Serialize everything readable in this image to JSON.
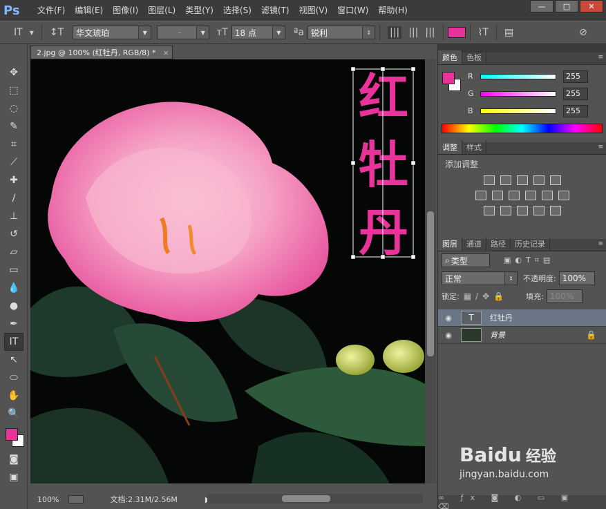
{
  "app": {
    "logo": "Ps"
  },
  "menus": [
    "文件(F)",
    "编辑(E)",
    "图像(I)",
    "图层(L)",
    "类型(Y)",
    "选择(S)",
    "滤镜(T)",
    "视图(V)",
    "窗口(W)",
    "帮助(H)"
  ],
  "window_buttons": [
    "—",
    "□",
    "✕"
  ],
  "options": {
    "font_family": "华文琥珀",
    "font_style": "-",
    "font_size": "18 点",
    "aa_label": "ªa",
    "antialias": "锐利",
    "text_color": "#e8339b"
  },
  "document": {
    "tab_title": "2.jpg @ 100% (红牡丹, RGB/8) *",
    "close": "×",
    "text_layer": [
      "红",
      "牡",
      "丹"
    ],
    "text_color": "#e8339b",
    "zoom": "100%",
    "doc_info": "文档:2.31M/2.56M"
  },
  "color_panel": {
    "tabs": [
      "颜色",
      "色板"
    ],
    "channels": [
      {
        "label": "R",
        "value": "255",
        "gradient": "linear-gradient(90deg,#00ffff,#ffffff)"
      },
      {
        "label": "G",
        "value": "255",
        "gradient": "linear-gradient(90deg,#ff00ff,#ffffff)"
      },
      {
        "label": "B",
        "value": "255",
        "gradient": "linear-gradient(90deg,#ffff00,#ffffff)"
      }
    ],
    "fg_color": "#e8339b",
    "bg_color": "#ffffff"
  },
  "adjust_panel": {
    "tabs": [
      "调整",
      "样式"
    ],
    "title": "添加调整"
  },
  "layers_panel": {
    "tabs": [
      "图层",
      "通道",
      "路径",
      "历史记录"
    ],
    "filter": "类型",
    "blend_mode": "正常",
    "opacity_label": "不透明度:",
    "opacity": "100%",
    "lock_label": "锁定:",
    "fill_label": "填充:",
    "fill": "100%",
    "layers": [
      {
        "name": "红牡丹",
        "thumb": "T",
        "selected": true
      },
      {
        "name": "背景",
        "thumb": "",
        "selected": false,
        "locked": true
      }
    ]
  },
  "watermark": {
    "brand": "Baidu",
    "cn": "经验",
    "url": "jingyan.baidu.com"
  }
}
